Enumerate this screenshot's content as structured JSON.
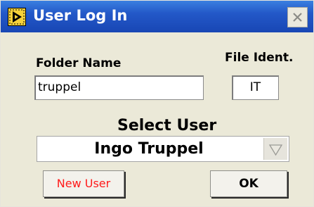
{
  "window": {
    "title": "User Log In"
  },
  "fields": {
    "folder_name_label": "Folder Name",
    "folder_name_value": "truppel",
    "file_ident_label": "File Ident.",
    "file_ident_value": "IT"
  },
  "select_user": {
    "label": "Select User",
    "selected": "Ingo Truppel"
  },
  "buttons": {
    "new_user": "New User",
    "ok": "OK"
  },
  "colors": {
    "titlebar": "#2358c8",
    "new_user_text": "#ff0000"
  }
}
